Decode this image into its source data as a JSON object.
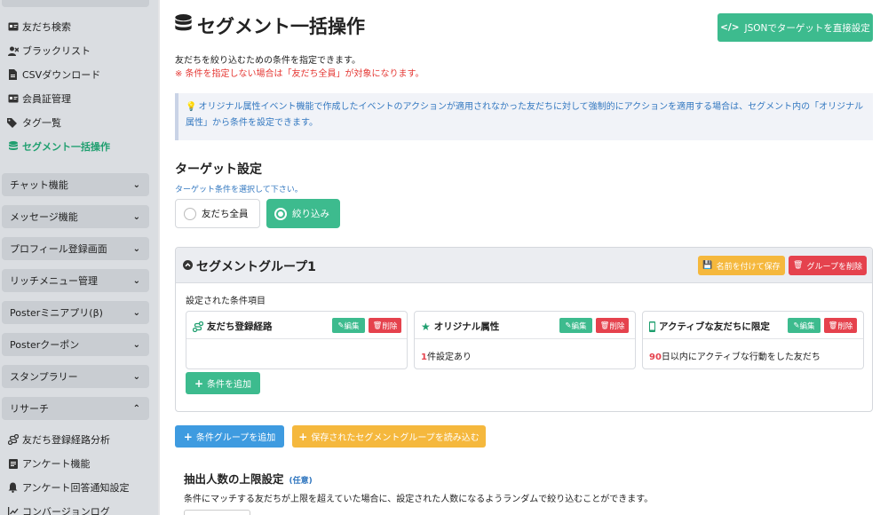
{
  "sidebar": {
    "items_top": [
      {
        "label": "友だち検索",
        "icon": "id-card-icon"
      },
      {
        "label": "ブラックリスト",
        "icon": "user-block-icon"
      },
      {
        "label": "CSVダウンロード",
        "icon": "file-csv-icon"
      },
      {
        "label": "会員証管理",
        "icon": "id-card-icon"
      },
      {
        "label": "タグ一覧",
        "icon": "tags-icon"
      },
      {
        "label": "セグメント一括操作",
        "icon": "database-icon",
        "active": true
      }
    ],
    "categories": [
      {
        "label": "チャット機能",
        "state": "collapsed"
      },
      {
        "label": "メッセージ機能",
        "state": "collapsed"
      },
      {
        "label": "プロフィール登録画面",
        "state": "collapsed"
      },
      {
        "label": "リッチメニュー管理",
        "state": "collapsed"
      },
      {
        "label": "Posterミニアプリ(β)",
        "state": "collapsed"
      },
      {
        "label": "Posterクーポン",
        "state": "collapsed"
      },
      {
        "label": "スタンプラリー",
        "state": "collapsed"
      },
      {
        "label": "リサーチ",
        "state": "expanded"
      }
    ],
    "research_items": [
      {
        "label": "友だち登録経路分析",
        "icon": "route-icon"
      },
      {
        "label": "アンケート機能",
        "icon": "form-icon"
      },
      {
        "label": "アンケート回答通知設定",
        "icon": "bell-icon"
      },
      {
        "label": "コンバージョンログ",
        "icon": "chart-icon"
      }
    ]
  },
  "header": {
    "title": "セグメント一括操作",
    "json_button": "JSONでターゲットを直接設定",
    "desc": "友だちを絞り込むための条件を指定できます。",
    "warning": "※ 条件を指定しない場合は「友だち全員」が対象になります。"
  },
  "info": {
    "text": "オリジナル属性イベント機能で作成したイベントのアクションが適用されなかった友だちに対して強制的にアクションを適用する場合は、セグメント内の「オリジナル属性」から条件を設定できます。"
  },
  "target": {
    "title": "ターゲット設定",
    "hint": "ターゲット条件を選択して下さい。",
    "option_all": "友だち全員",
    "option_narrow": "絞り込み",
    "selected": "絞り込み"
  },
  "segment_group": {
    "title": "セグメントグループ1",
    "save_button": "名前を付けて保存",
    "delete_button": "グループを削除",
    "conditions_label": "設定された条件項目",
    "cards": [
      {
        "title": "友だち登録経路",
        "icon": "route-icon",
        "edit": "編集",
        "delete": "削除",
        "body_num": "",
        "body_text": ""
      },
      {
        "title": "オリジナル属性",
        "icon": "star-icon",
        "edit": "編集",
        "delete": "削除",
        "body_num": "1",
        "body_text": "件設定あり"
      },
      {
        "title": "アクティブな友だちに限定",
        "icon": "mobile-icon",
        "edit": "編集",
        "delete": "削除",
        "body_num": "90",
        "body_text": "日以内にアクティブな行動をした友だち"
      }
    ],
    "add_condition": "条件を追加"
  },
  "actions": {
    "add_group": "条件グループを追加",
    "load_group": "保存されたセグメントグループを読み込む"
  },
  "limit": {
    "title": "抽出人数の上限設定",
    "optional": "(任意)",
    "desc": "条件にマッチする友だちが上限を超えていた場合に、設定された人数になるようランダムで絞り込むことができます。"
  },
  "colors": {
    "primary_green": "#3dbb8e",
    "danger_red": "#e5424d",
    "warning_yellow": "#f5b83d",
    "info_blue": "#3e9be0",
    "link_blue": "#3378c0"
  }
}
